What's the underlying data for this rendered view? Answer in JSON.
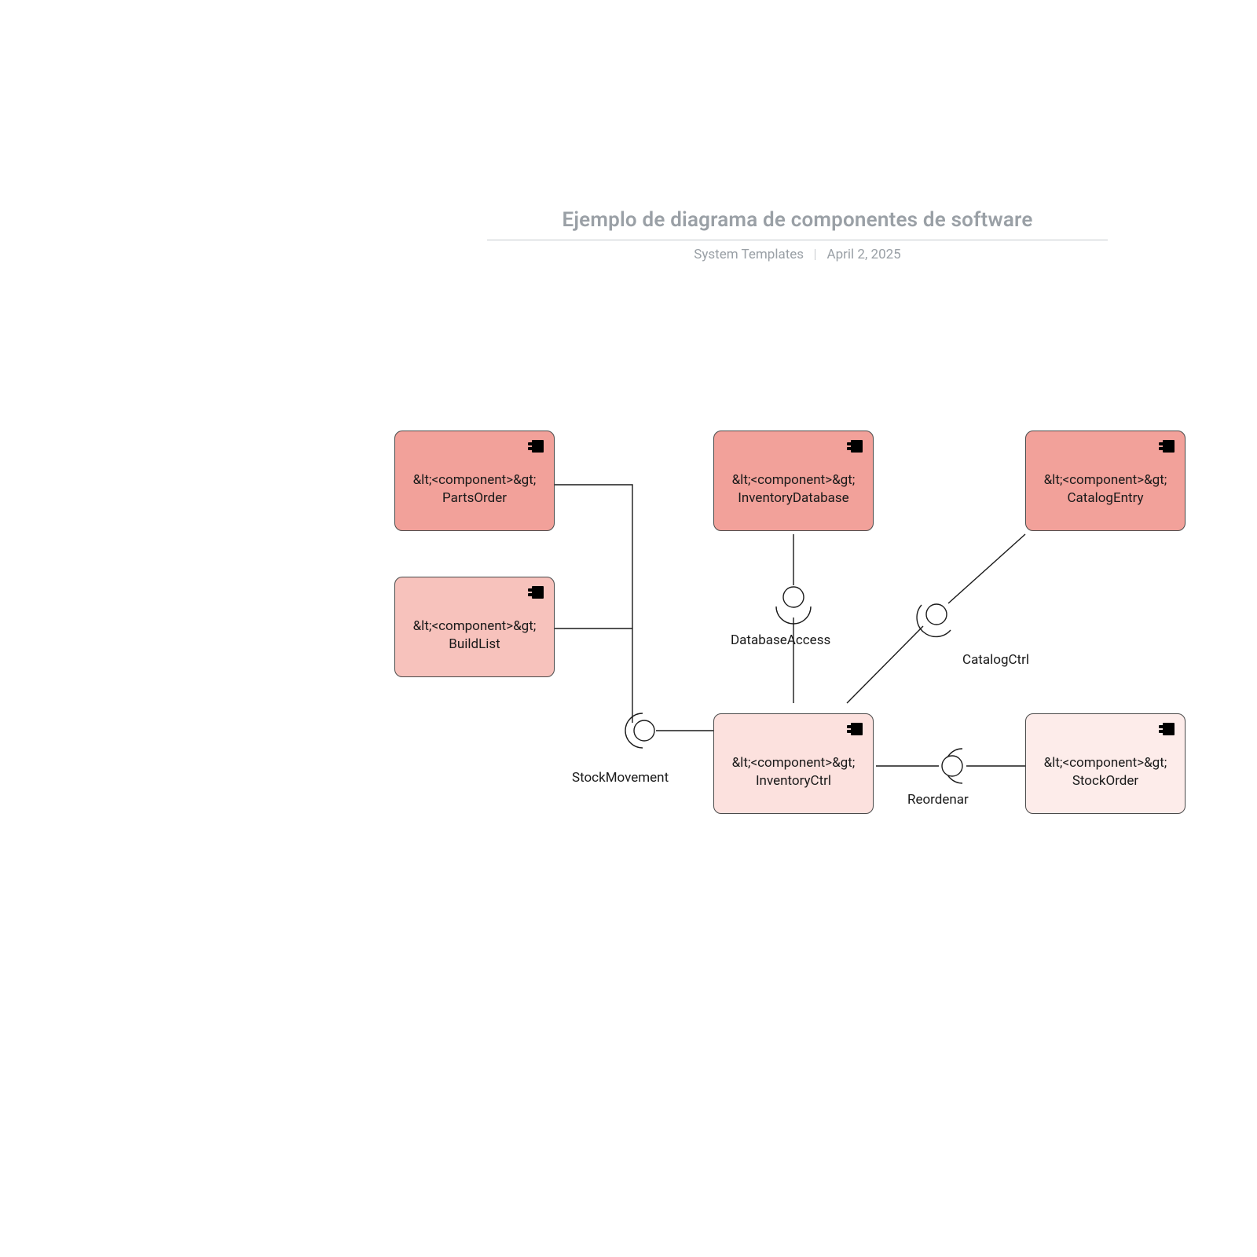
{
  "header": {
    "title": "Ejemplo de diagrama de componentes de software",
    "author": "System Templates",
    "date": "April 2, 2025"
  },
  "stereotype_literal": "&lt;<component>&gt;",
  "components": {
    "parts_order": {
      "name": "PartsOrder"
    },
    "build_list": {
      "name": "BuildList"
    },
    "inventory_database": {
      "name": "InventoryDatabase"
    },
    "catalog_entry": {
      "name": "CatalogEntry"
    },
    "inventory_ctrl": {
      "name": "InventoryCtrl"
    },
    "stock_order": {
      "name": "StockOrder"
    }
  },
  "connectors": {
    "stock_movement": {
      "label": "StockMovement"
    },
    "database_access": {
      "label": "DatabaseAccess"
    },
    "catalog_ctrl": {
      "label": "CatalogCtrl"
    },
    "reorder": {
      "label": "Reordenar"
    }
  }
}
